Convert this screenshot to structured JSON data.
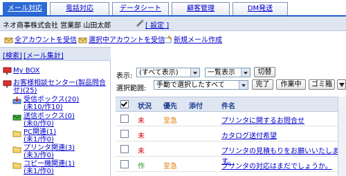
{
  "tabs": [
    {
      "label": "メール対応",
      "active": true
    },
    {
      "label": "電話対応",
      "active": false
    },
    {
      "label": "データシート",
      "active": false
    },
    {
      "label": "顧客管理",
      "active": false
    },
    {
      "label": "DM発送",
      "active": false
    }
  ],
  "user": {
    "company_dept_name": "ネオ商事株式会社 営業部 山田太郎",
    "settings_label": "[ 設定 ]"
  },
  "toolbar": {
    "receive_all": "全アカウントを受信",
    "receive_selected": "選択中アカウントを受信",
    "new_mail": "新規メール作成"
  },
  "left": {
    "search": "[検索]",
    "mail_stats": "[メール集計]",
    "tree": [
      {
        "label": "My BOX",
        "icon": "mailbox-icon"
      },
      {
        "label": "お客様相談センター(製品問合せ)(25)",
        "icon": "mailbox-icon"
      },
      {
        "label": "受信ボックス(20)\n(未10/作10)",
        "icon": "inbox-icon"
      },
      {
        "label": "送信ボックス(0)\n(未0/作0)",
        "icon": "outbox-icon"
      },
      {
        "label": "PC関連(1)\n(未1/作0)",
        "icon": "folder-icon"
      },
      {
        "label": "プリンタ関連(3)\n(未3/作0)",
        "icon": "folder-icon"
      },
      {
        "label": "コピー機関連(1)\n(未1/作0)",
        "icon": "folder-icon"
      }
    ]
  },
  "controls": {
    "display_label": "表示:",
    "display_value": "(すべて表示)",
    "list_value": "一覧表示",
    "switch_button": "切替",
    "range_label": "選択範囲:",
    "range_value": "手動で選択したすべて",
    "done_button": "完了",
    "working_button": "作業中",
    "trash_button": "ゴミ箱"
  },
  "table": {
    "headers": {
      "status": "状況",
      "priority": "優先",
      "attach": "添付",
      "subject": "件名"
    },
    "rows": [
      {
        "status": "未",
        "status_color": "#d40000",
        "priority": "至急",
        "subject": "プリンタに関するお問合せ"
      },
      {
        "status": "未",
        "status_color": "#d40000",
        "priority": "",
        "subject": "カタログ送付希望"
      },
      {
        "status": "未",
        "status_color": "#d40000",
        "priority": "",
        "subject": "プリンタの見積もりをお願いいたします。"
      },
      {
        "status": "作",
        "status_color": "#1e8e1e",
        "priority": "至急",
        "subject": "プリンタの対応はまだでしょうか。"
      }
    ]
  }
}
